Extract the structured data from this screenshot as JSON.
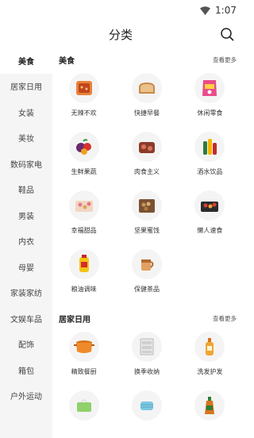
{
  "status": {
    "time": "1:07"
  },
  "header": {
    "title": "分类"
  },
  "sidebar": {
    "items": [
      {
        "label": "美食"
      },
      {
        "label": "居家日用"
      },
      {
        "label": "女装"
      },
      {
        "label": "美妆"
      },
      {
        "label": "数码家电"
      },
      {
        "label": "鞋品"
      },
      {
        "label": "男装"
      },
      {
        "label": "内衣"
      },
      {
        "label": "母婴"
      },
      {
        "label": "家装家纺"
      },
      {
        "label": "文娱车品"
      },
      {
        "label": "配饰"
      },
      {
        "label": "箱包"
      },
      {
        "label": "户外运动"
      }
    ]
  },
  "sections": [
    {
      "title": "美食",
      "more": "查看更多",
      "items": [
        {
          "label": "无辣不欢",
          "icon": "spicy-food-icon"
        },
        {
          "label": "快捷早餐",
          "icon": "bread-icon"
        },
        {
          "label": "休闲零食",
          "icon": "snack-bag-icon"
        },
        {
          "label": "生鲜果蔬",
          "icon": "fruit-icon"
        },
        {
          "label": "肉食主义",
          "icon": "meat-icon"
        },
        {
          "label": "酒水饮品",
          "icon": "drinks-icon"
        },
        {
          "label": "幸福甜品",
          "icon": "dessert-icon"
        },
        {
          "label": "坚果蜜饯",
          "icon": "nuts-icon"
        },
        {
          "label": "懒人速食",
          "icon": "instant-noodle-icon"
        },
        {
          "label": "粮油调味",
          "icon": "oil-icon"
        },
        {
          "label": "保健茶品",
          "icon": "tea-icon"
        }
      ]
    },
    {
      "title": "居家日用",
      "more": "查看更多",
      "items": [
        {
          "label": "精致餐厨",
          "icon": "pot-icon"
        },
        {
          "label": "换季收纳",
          "icon": "storage-drawer-icon"
        },
        {
          "label": "洗发护发",
          "icon": "shampoo-icon"
        },
        {
          "label": "",
          "icon": "tissue-icon"
        },
        {
          "label": "",
          "icon": "mask-icon"
        },
        {
          "label": "",
          "icon": "cleaner-bottle-icon"
        }
      ]
    }
  ]
}
